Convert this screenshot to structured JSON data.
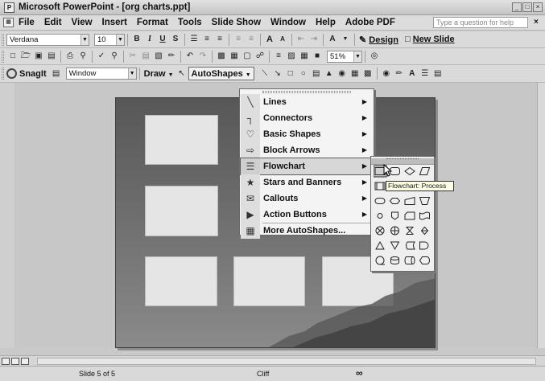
{
  "window": {
    "title": "Microsoft PowerPoint - [org charts.ppt]",
    "icon_text": "P"
  },
  "menubar": {
    "items": [
      "File",
      "Edit",
      "View",
      "Insert",
      "Format",
      "Tools",
      "Slide Show",
      "Window",
      "Help",
      "Adobe PDF"
    ],
    "help_placeholder": "Type a question for help",
    "close_glyph": "×"
  },
  "format_toolbar": {
    "font": "Verdana",
    "size": "10",
    "buttons": [
      "B",
      "I",
      "U",
      "S"
    ],
    "grow_font": "A",
    "shrink_font": "A",
    "font_color": "A",
    "design_label": "Design",
    "new_slide_label": "New Slide"
  },
  "standard_toolbar": {
    "zoom": "51%"
  },
  "drawing_toolbar": {
    "snagit_label": "SnagIt",
    "capture_mode": "Window",
    "draw_label": "Draw",
    "autoshapes_label": "AutoShapes"
  },
  "autoshapes_menu": {
    "items": [
      {
        "label": "Lines",
        "icon": "lines-icon",
        "glyph": "╲",
        "submenu": true
      },
      {
        "label": "Connectors",
        "icon": "connectors-icon",
        "glyph": "┐",
        "submenu": true
      },
      {
        "label": "Basic Shapes",
        "icon": "basic-shapes-icon",
        "glyph": "♡",
        "submenu": true
      },
      {
        "label": "Block Arrows",
        "icon": "block-arrows-icon",
        "glyph": "⇨",
        "submenu": true
      },
      {
        "label": "Flowchart",
        "icon": "flowchart-icon",
        "glyph": "☰",
        "submenu": true,
        "highlighted": true
      },
      {
        "label": "Stars and Banners",
        "icon": "stars-icon",
        "glyph": "★",
        "submenu": true
      },
      {
        "label": "Callouts",
        "icon": "callouts-icon",
        "glyph": "✉",
        "submenu": true
      },
      {
        "label": "Action Buttons",
        "icon": "action-buttons-icon",
        "glyph": "▶",
        "submenu": true
      },
      {
        "label": "More AutoShapes...",
        "icon": "more-autoshapes-icon",
        "glyph": "▦",
        "submenu": false
      }
    ]
  },
  "flowchart_submenu": {
    "tooltip": "Flowchart: Process",
    "shapes": [
      "process",
      "alternate-process",
      "decision",
      "data",
      "predefined-process",
      "internal-storage",
      "document",
      "multidocument",
      "terminator",
      "preparation",
      "manual-input",
      "manual-operation",
      "connector",
      "off-page-connector",
      "card",
      "punched-tape",
      "summing-junction",
      "or",
      "collate",
      "sort",
      "extract",
      "merge",
      "stored-data",
      "delay",
      "sequential-access-storage",
      "magnetic-disk",
      "direct-access-storage",
      "display"
    ]
  },
  "status": {
    "slide": "Slide 5 of 5",
    "design": "Cliff"
  }
}
